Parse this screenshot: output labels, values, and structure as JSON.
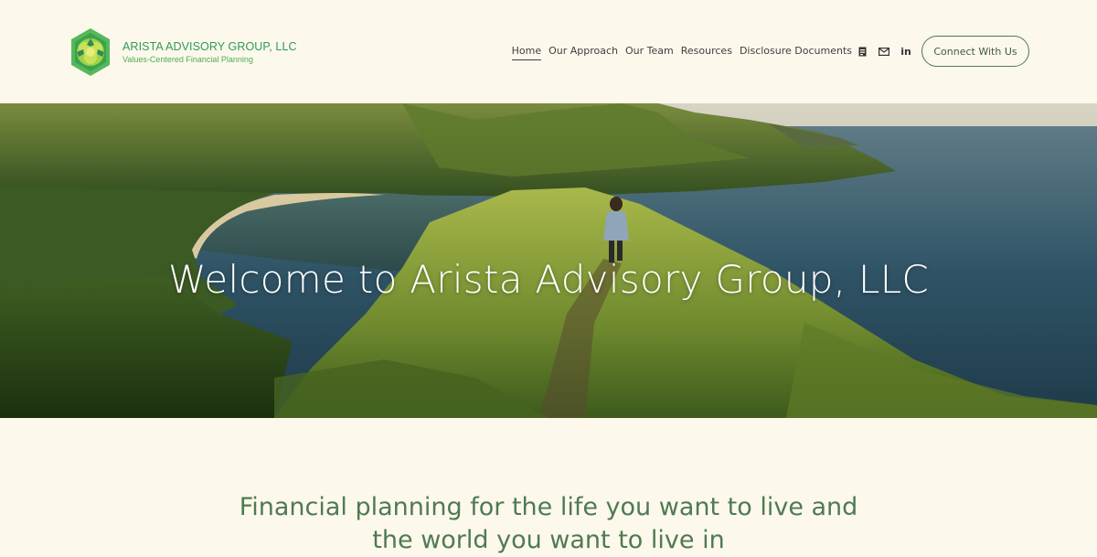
{
  "brand": {
    "name": "ARISTA ADVISORY GROUP, LLC",
    "tagline": "Values-Centered Financial Planning",
    "colors": {
      "primary": "#2f9a5a",
      "accent": "#4f7a52",
      "background": "#fdf8ec"
    }
  },
  "nav": {
    "items": [
      {
        "label": "Home",
        "active": true
      },
      {
        "label": "Our Approach",
        "active": false
      },
      {
        "label": "Our Team",
        "active": false
      },
      {
        "label": "Resources",
        "active": false
      },
      {
        "label": "Disclosure Documents",
        "active": false
      }
    ],
    "social_icons": [
      "calendar-icon",
      "email-icon",
      "linkedin-icon"
    ],
    "linkedin_glyph": "in",
    "cta_label": "Connect With Us"
  },
  "hero": {
    "title": "Welcome to Arista Advisory Group, LLC",
    "image": "coastal-ridge-hiker-photo"
  },
  "intro": {
    "heading": "Financial planning for the life you want to live and the world you want to live in"
  }
}
